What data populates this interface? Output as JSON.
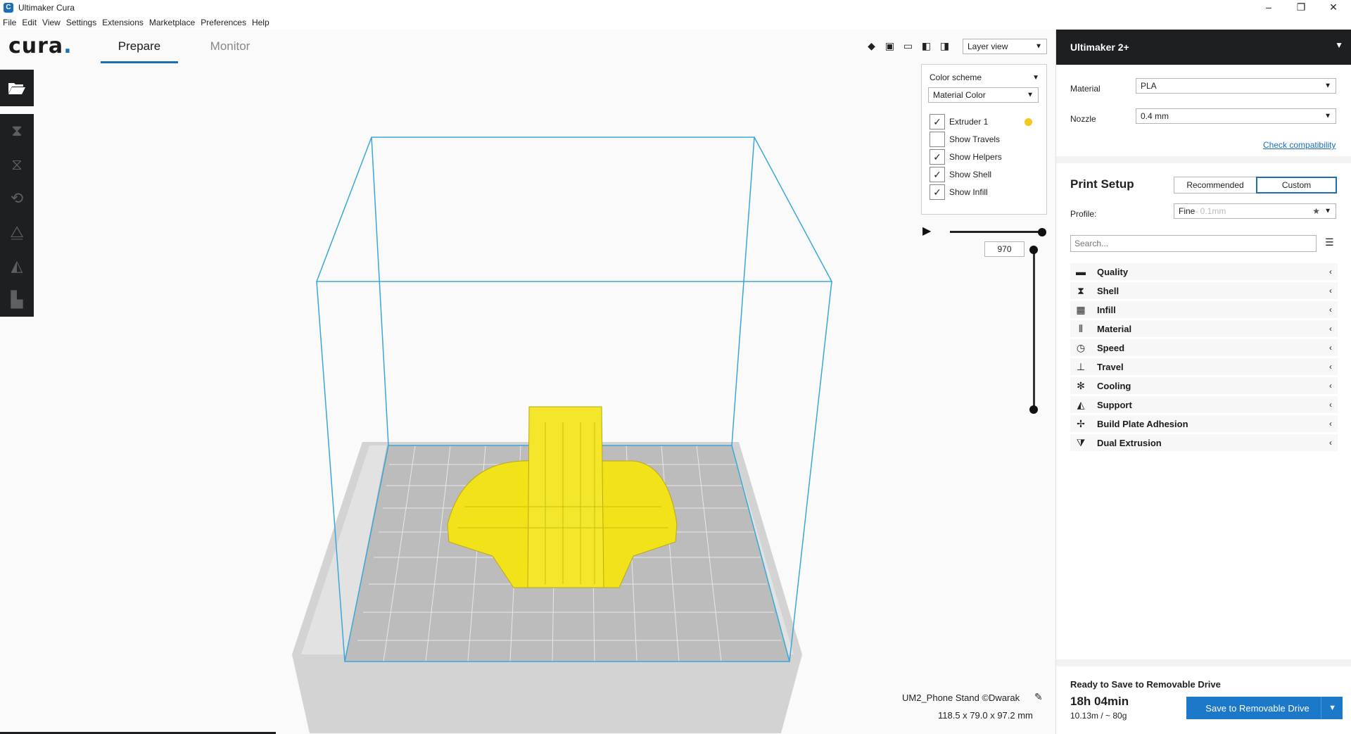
{
  "window": {
    "title": "Ultimaker Cura",
    "minimize": "–",
    "maximize": "❐",
    "close": "✕"
  },
  "menu": [
    "File",
    "Edit",
    "View",
    "Settings",
    "Extensions",
    "Marketplace",
    "Preferences",
    "Help"
  ],
  "logo": {
    "text": "cura",
    "dot": "."
  },
  "tabs": {
    "prepare": "Prepare",
    "monitor": "Monitor"
  },
  "view_mode": "Layer view",
  "layer_panel": {
    "color_scheme_label": "Color scheme",
    "color_scheme_value": "Material Color",
    "items": [
      {
        "label": "Extruder 1",
        "checked": true
      },
      {
        "label": "Show Travels",
        "checked": false
      },
      {
        "label": "Show Helpers",
        "checked": true
      },
      {
        "label": "Show Shell",
        "checked": true
      },
      {
        "label": "Show Infill",
        "checked": true
      }
    ],
    "extruder_color": "#f4c91e",
    "layer_value": "970"
  },
  "object": {
    "name": "UM2_Phone Stand ©Dwarak",
    "dimensions": "118.5 x 79.0 x 97.2 mm"
  },
  "sidebar": {
    "machine": "Ultimaker 2+",
    "material_label": "Material",
    "material_value": "PLA",
    "nozzle_label": "Nozzle",
    "nozzle_value": "0.4 mm",
    "check_compat": "Check compatibility",
    "print_setup": "Print Setup",
    "recommended": "Recommended",
    "custom": "Custom",
    "profile_label": "Profile:",
    "profile_value": "Fine",
    "profile_detail": " - 0.1mm",
    "search_placeholder": "Search...",
    "categories": [
      {
        "label": "Quality",
        "icon": "quality-icon"
      },
      {
        "label": "Shell",
        "icon": "shell-icon"
      },
      {
        "label": "Infill",
        "icon": "infill-icon"
      },
      {
        "label": "Material",
        "icon": "material-icon"
      },
      {
        "label": "Speed",
        "icon": "speed-icon"
      },
      {
        "label": "Travel",
        "icon": "travel-icon"
      },
      {
        "label": "Cooling",
        "icon": "cooling-icon"
      },
      {
        "label": "Support",
        "icon": "support-icon"
      },
      {
        "label": "Build Plate Adhesion",
        "icon": "adhesion-icon"
      },
      {
        "label": "Dual Extrusion",
        "icon": "dual-extrusion-icon"
      }
    ],
    "ready_text": "Ready to Save to Removable Drive",
    "print_time": "18h 04min",
    "print_material": "10.13m / ~ 80g",
    "save_button": "Save to Removable Drive"
  },
  "colors": {
    "accent": "#1c6eb5",
    "dark": "#1d1f21",
    "model": "#f2e21a",
    "build_volume": "#3aa7d8"
  }
}
